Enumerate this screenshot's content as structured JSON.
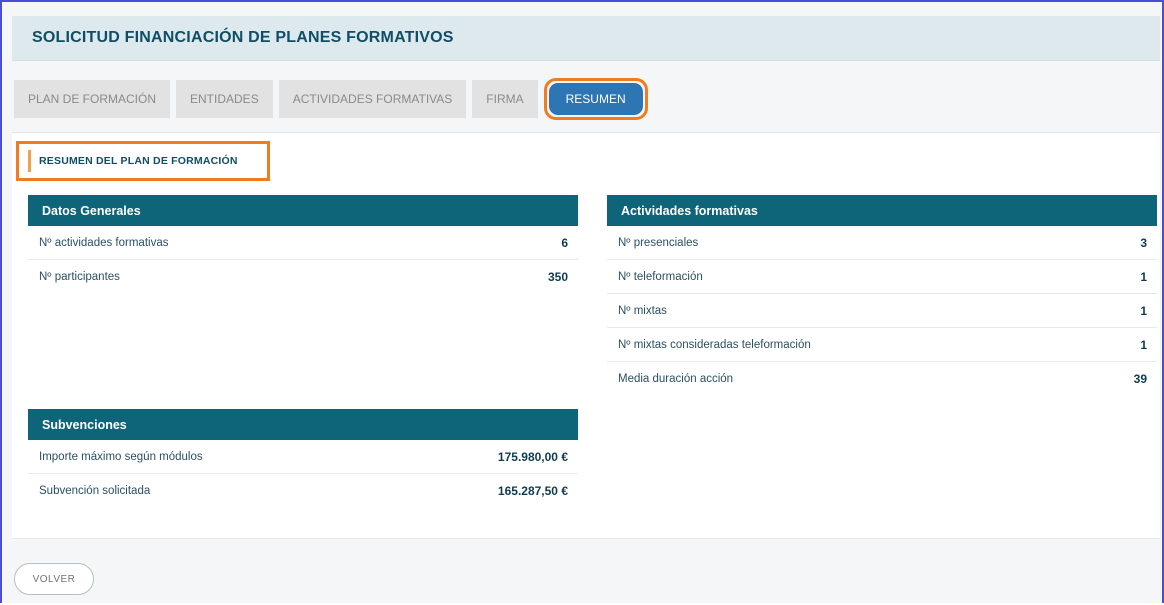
{
  "header": {
    "title": "SOLICITUD FINANCIACIÓN DE PLANES FORMATIVOS"
  },
  "tabs": [
    {
      "label": "PLAN DE FORMACIÓN"
    },
    {
      "label": "ENTIDADES"
    },
    {
      "label": "ACTIVIDADES FORMATIVAS"
    },
    {
      "label": "FIRMA"
    },
    {
      "label": "RESUMEN",
      "active": true
    }
  ],
  "section": {
    "title": "RESUMEN DEL PLAN DE FORMACIÓN"
  },
  "datos_generales": {
    "title": "Datos Generales",
    "rows": [
      {
        "label": "Nº actividades formativas",
        "value": "6"
      },
      {
        "label": "Nº participantes",
        "value": "350"
      }
    ]
  },
  "actividades_formativas": {
    "title": "Actividades formativas",
    "rows": [
      {
        "label": "Nº presenciales",
        "value": "3"
      },
      {
        "label": "Nº teleformación",
        "value": "1"
      },
      {
        "label": "Nº mixtas",
        "value": "1"
      },
      {
        "label": "Nº mixtas consideradas teleformación",
        "value": "1"
      },
      {
        "label": "Media duración acción",
        "value": "39"
      }
    ]
  },
  "subvenciones": {
    "title": "Subvenciones",
    "rows": [
      {
        "label": "Importe máximo según módulos",
        "value": "175.980,00 €"
      },
      {
        "label": "Subvención solicitada",
        "value": "165.287,50 €"
      }
    ]
  },
  "footer": {
    "back_label": "VOLVER"
  },
  "colors": {
    "accent_orange": "#f07c22",
    "panel_header": "#0e6478",
    "active_tab": "#2e75b3",
    "frame_border": "#4a4fd6"
  }
}
